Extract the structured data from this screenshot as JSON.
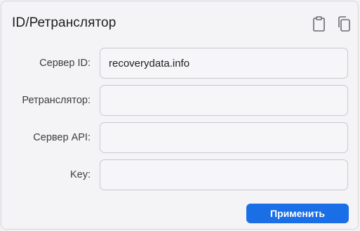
{
  "panel": {
    "title": "ID/Ретранслятор",
    "icons": {
      "paste": "clipboard-icon",
      "copy": "copy-icon"
    }
  },
  "fields": [
    {
      "label": "Сервер ID:",
      "value": "recoverydata.info",
      "placeholder": ""
    },
    {
      "label": "Ретранслятор:",
      "value": "",
      "placeholder": ""
    },
    {
      "label": "Сервер API:",
      "value": "",
      "placeholder": ""
    },
    {
      "label": "Key:",
      "value": "",
      "placeholder": ""
    }
  ],
  "actions": {
    "apply_label": "Применить"
  },
  "colors": {
    "accent": "#1a6fe6",
    "background": "#f4f4f7",
    "border": "#c8c8cf"
  }
}
